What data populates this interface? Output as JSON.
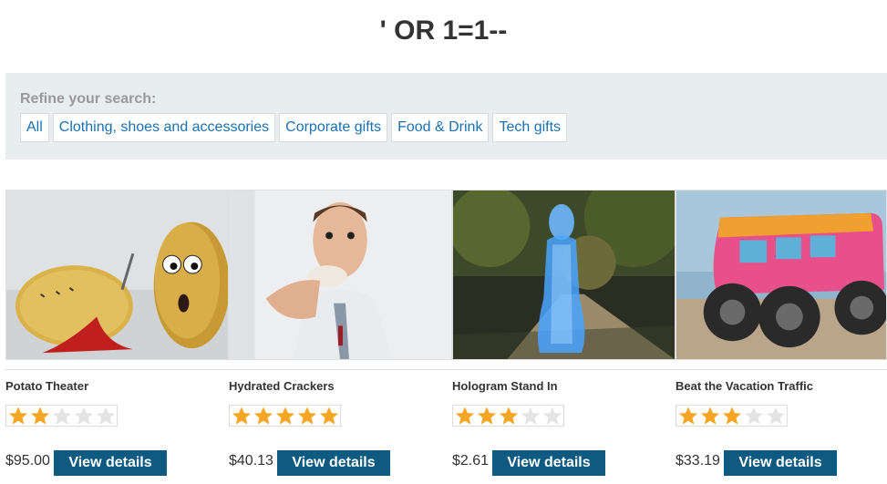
{
  "page": {
    "title": "' OR 1=1--"
  },
  "refine": {
    "label": "Refine your search:",
    "filters": [
      "All",
      "Clothing, shoes and accessories",
      "Corporate gifts",
      "Food & Drink",
      "Tech gifts"
    ]
  },
  "products": [
    {
      "name": "Potato Theater",
      "rating": 2,
      "price": "$95.00",
      "button": "View details"
    },
    {
      "name": "Hydrated Crackers",
      "rating": 5,
      "price": "$40.13",
      "button": "View details"
    },
    {
      "name": "Hologram Stand In",
      "rating": 3,
      "price": "$2.61",
      "button": "View details"
    },
    {
      "name": "Beat the Vacation Traffic",
      "rating": 3,
      "price": "$33.19",
      "button": "View details"
    }
  ],
  "rating_max": 5,
  "colors": {
    "accent": "#0f5a80",
    "link": "#1a70b0",
    "star_filled": "#f5a623",
    "star_empty": "#e4e4e4",
    "panel": "#e8edf0"
  }
}
